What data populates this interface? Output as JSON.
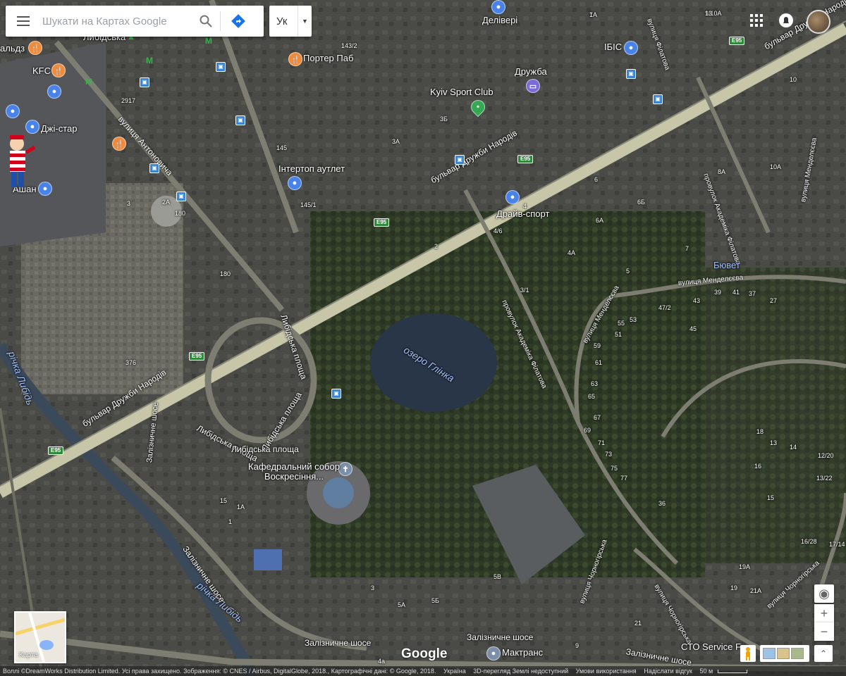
{
  "search": {
    "placeholder": "Шукати на Картах Google"
  },
  "lang": {
    "label": "Ук"
  },
  "layers": {
    "label": "Карта"
  },
  "logo": "Google",
  "footer": {
    "attribution": "Воллі ©DreamWorks Distribution Limited. Усі права захищено. Зображення: © CNES / Airbus, DigitalGlobe, 2018., Картографічні дані: © Google, 2018.",
    "country": "Україна",
    "earth_3d": "3D-перегляд Землі недоступний",
    "terms": "Умови використання",
    "feedback": "Надіслати відгук",
    "scale": "50 м"
  },
  "places": [
    {
      "id": "delivery",
      "label": "Делівері",
      "type": "blue"
    },
    {
      "id": "porter",
      "label": "Портер Паб",
      "type": "orange"
    },
    {
      "id": "druzhba",
      "label": "Дружба",
      "type": "purple"
    },
    {
      "id": "kyiv-sport",
      "label": "Kyiv Sport Club",
      "type": "green"
    },
    {
      "id": "ibis",
      "label": "ІБІС",
      "type": "blue"
    },
    {
      "id": "intertop",
      "label": "Інтертоп аутлет",
      "type": "blue"
    },
    {
      "id": "drive-sport",
      "label": "Драйв-спорт",
      "type": "blue"
    },
    {
      "id": "kfc",
      "label": "KFC",
      "type": "orange"
    },
    {
      "id": "mcdonalds",
      "label": "альдз",
      "type": "orange"
    },
    {
      "id": "jistar",
      "label": "Джі-стар",
      "type": "blue"
    },
    {
      "id": "auchan",
      "label": "Ашан",
      "type": "blue"
    },
    {
      "id": "cathedral",
      "label": "Кафедральний собор Воскресіння...",
      "type": "grey"
    },
    {
      "id": "maktrans",
      "label": "Мактранс",
      "type": "grey"
    },
    {
      "id": "buvet",
      "label": "Бювет",
      "type": "text"
    },
    {
      "id": "sto",
      "label": "СТО Service F",
      "type": "text"
    },
    {
      "id": "lybidska-metro",
      "label": "Либідська",
      "type": "metro"
    }
  ],
  "roads": [
    {
      "id": "bulvar-1",
      "label": "бульвар Дружби Народів"
    },
    {
      "id": "bulvar-2",
      "label": "бульвар Дружби Народів"
    },
    {
      "id": "bulvar-3",
      "label": "бульвар Дружби Народів"
    },
    {
      "id": "antonovycha",
      "label": "вулиця Антоновича"
    },
    {
      "id": "lybidska-ploshcha-1",
      "label": "Либідська площа"
    },
    {
      "id": "lybidska-ploshcha-2",
      "label": "Либідська площа"
    },
    {
      "id": "lybidska-ploshcha-3",
      "label": "Либідська площа"
    },
    {
      "id": "lybidska-ploshcha-4",
      "label": "Либідська площа"
    },
    {
      "id": "filatova-1",
      "label": "провулок Академіка Філатова"
    },
    {
      "id": "filatova-2",
      "label": "провулок Академіка Філатова"
    },
    {
      "id": "filatova-3",
      "label": "вулиця Філатова"
    },
    {
      "id": "mendeleieva-1",
      "label": "вулиця Менделєєва"
    },
    {
      "id": "mendeleieva-2",
      "label": "вулиця Менделєєва"
    },
    {
      "id": "mendeleieva-3",
      "label": "вулиця Менделєєва"
    },
    {
      "id": "zaliznychne-1",
      "label": "Залізничне шосе"
    },
    {
      "id": "zaliznychne-2",
      "label": "Залізничне шосе"
    },
    {
      "id": "zaliznychne-3",
      "label": "Залізничне шосе"
    },
    {
      "id": "zaliznychne-4",
      "label": "Залізничне шосе"
    },
    {
      "id": "zaliznychne-5",
      "label": "Залізничне шосе"
    },
    {
      "id": "chornohirska-1",
      "label": "вулиця Чорногірська"
    },
    {
      "id": "chornohirska-2",
      "label": "вулиця Чорногірська"
    },
    {
      "id": "chornohirska-3",
      "label": "вулиця Чорногірська"
    }
  ],
  "water": [
    {
      "id": "lake",
      "label": "озеро Глінка"
    },
    {
      "id": "river-1",
      "label": "річка Либідь"
    },
    {
      "id": "river-2",
      "label": "річка Либідь"
    }
  ],
  "shields": [
    "E95",
    "E95",
    "E95",
    "E95",
    "E95"
  ],
  "house_numbers": [
    "7A",
    "9/10A",
    "143/2",
    "3Б",
    "3A",
    "145",
    "145/1",
    "2917",
    "180",
    "180",
    "376",
    "4",
    "4/6",
    "2",
    "3/1",
    "6",
    "6A",
    "6Б",
    "4A",
    "5",
    "8A",
    "10A",
    "7",
    "10",
    "41",
    "39",
    "37",
    "43",
    "27",
    "47/2",
    "55",
    "53",
    "51",
    "45",
    "59",
    "61",
    "63",
    "65",
    "67",
    "69",
    "71",
    "73",
    "75",
    "77",
    "36",
    "18",
    "13",
    "14",
    "12/20",
    "16",
    "13/22",
    "15",
    "16/28",
    "17/14",
    "19A",
    "19",
    "21A",
    "21",
    "15",
    "1A",
    "1",
    "3",
    "5A",
    "5Б",
    "5В",
    "9",
    "4a",
    "2A",
    "3",
    "1",
    "13"
  ]
}
